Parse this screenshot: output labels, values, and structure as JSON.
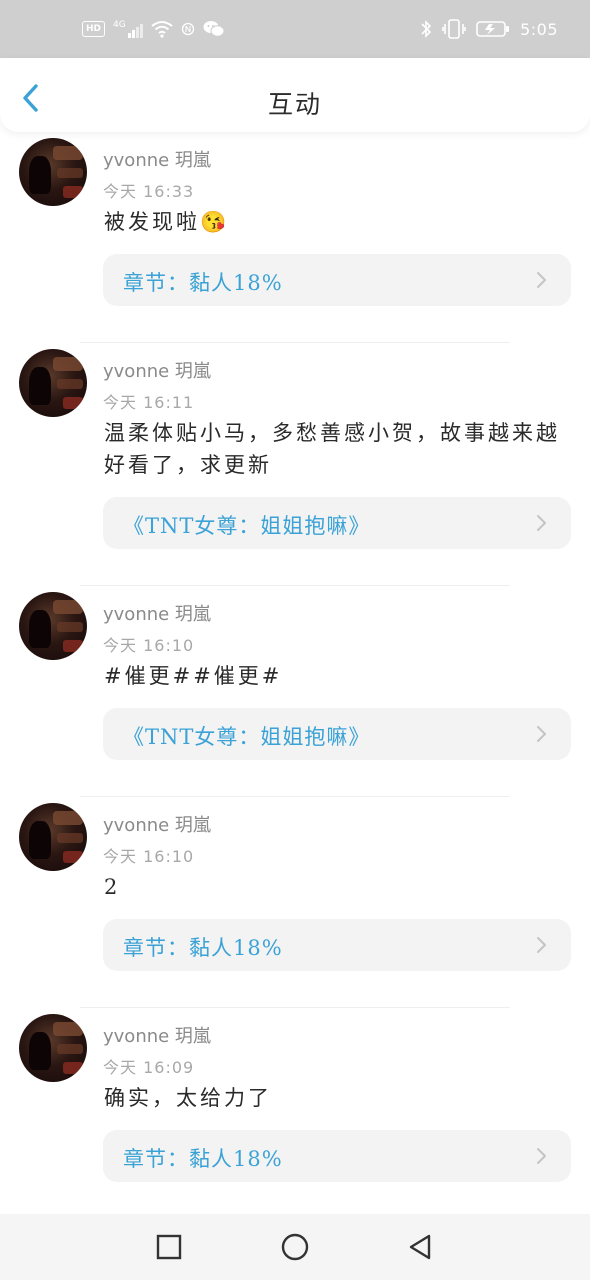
{
  "status_bar": {
    "hd": "HD",
    "network": "4G",
    "time": "5:05",
    "icons": [
      "signal-icon",
      "wifi-icon",
      "nfc-icon",
      "wechat-icon",
      "bluetooth-icon",
      "vibrate-icon",
      "battery-charging-icon"
    ]
  },
  "header": {
    "title": "互动",
    "back_icon": "chevron-left-icon"
  },
  "items": [
    {
      "user": "yvonne 玥嵐",
      "time": "今天  16:33",
      "comment": "被发现啦😘",
      "link": "章节：黏人18%"
    },
    {
      "user": "yvonne 玥嵐",
      "time": "今天  16:11",
      "comment": "温柔体贴小马，多愁善感小贺，故事越来越好看了，求更新",
      "link": "《TNT女尊：姐姐抱嘛》"
    },
    {
      "user": "yvonne 玥嵐",
      "time": "今天  16:10",
      "comment": "#催更##催更#",
      "link": "《TNT女尊：姐姐抱嘛》"
    },
    {
      "user": "yvonne 玥嵐",
      "time": "今天  16:10",
      "comment": "2",
      "link": "章节：黏人18%"
    },
    {
      "user": "yvonne 玥嵐",
      "time": "今天  16:09",
      "comment": "确实，太给力了",
      "link": "章节：黏人18%"
    }
  ],
  "nav_bar": {
    "icons": [
      "square-recents-icon",
      "circle-home-icon",
      "triangle-back-icon"
    ]
  },
  "colors": {
    "accent": "#3aa2d6",
    "status_bar": "#cfcfcf"
  }
}
